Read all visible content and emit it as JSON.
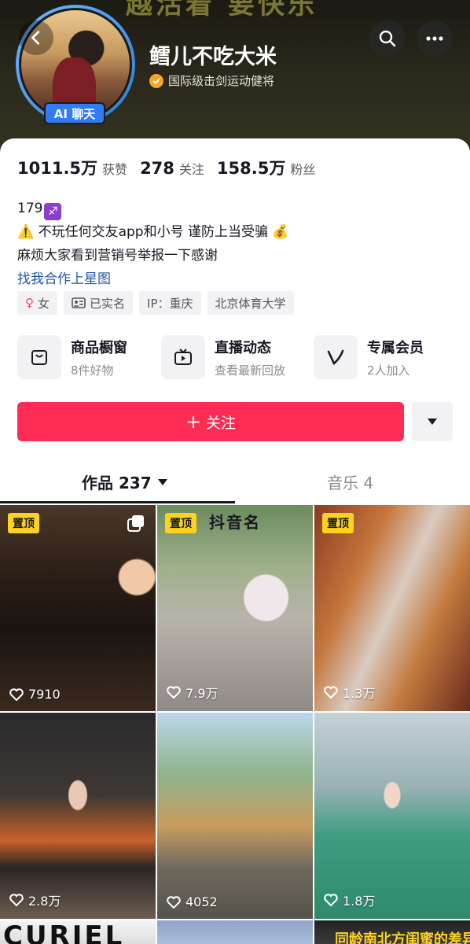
{
  "header": {
    "banner_text": "越活着 要快乐",
    "nickname": "鳕儿不吃大米",
    "verification": "国际级击剑运动健将",
    "ai_badge": "AI 聊天"
  },
  "stats": [
    {
      "num": "1011.5万",
      "label": "获赞"
    },
    {
      "num": "278",
      "label": "关注"
    },
    {
      "num": "158.5万",
      "label": "粉丝"
    }
  ],
  "bio": {
    "line1": "179",
    "line1_emoji": "♐",
    "line2": "不玩任何交友app和小号 谨防上当受骗",
    "line3": "麻烦大家看到营销号举报一下感谢",
    "link": "找我合作上星图"
  },
  "tags": {
    "gender_symbol": "♀",
    "gender": "女",
    "realname": "已实名",
    "ip": "IP：重庆",
    "school": "北京体育大学"
  },
  "shortcuts": [
    {
      "title": "商品橱窗",
      "sub": "8件好物"
    },
    {
      "title": "直播动态",
      "sub": "查看最新回放"
    },
    {
      "title": "专属会员",
      "sub": "2人加入"
    }
  ],
  "follow": {
    "label": "关注",
    "plus": "+"
  },
  "tabs": {
    "works": "作品 237",
    "music": "音乐 4"
  },
  "grid": {
    "pin_label": "置顶",
    "items": [
      {
        "likes": "7910"
      },
      {
        "likes": "7.9万",
        "overlay": "抖音名"
      },
      {
        "likes": "1.3万"
      },
      {
        "likes": "2.8万"
      },
      {
        "likes": "4052"
      },
      {
        "likes": "1.8万"
      }
    ],
    "bottom_row": {
      "left_text": "CURIEL",
      "right_text": "同龄南北方闺蜜的差异"
    }
  },
  "colors": {
    "follow": "#fe2c55",
    "pin": "#ffd21f",
    "link": "#2456a5",
    "ai_badge": "#2f7cf6"
  }
}
